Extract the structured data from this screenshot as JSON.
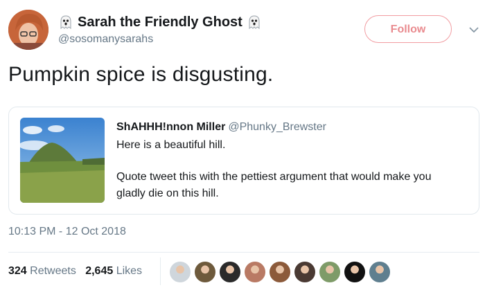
{
  "author": {
    "display_name": "Sarah the Friendly Ghost",
    "handle": "@sosomanysarahs",
    "name_emoji": "ghost-icon"
  },
  "follow_button": {
    "label": "Follow"
  },
  "menu_icon": "chevron-down-icon",
  "tweet": {
    "text": "Pumpkin spice is disgusting."
  },
  "quoted_tweet": {
    "display_name": "ShAHHH!nnon Miller",
    "handle": "@Phunky_Brewster",
    "line1": "Here is a beautiful hill.",
    "line2": "Quote tweet this with the pettiest argument that would make you",
    "line3": "gladly die on this hill."
  },
  "timestamp": "10:13 PM - 12 Oct 2018",
  "stats": {
    "retweets_count": "324",
    "retweets_label": "Retweets",
    "likes_count": "2,645",
    "likes_label": "Likes"
  },
  "likers": [
    {
      "name": "liker-avatar-1",
      "color": "#cfd6dc"
    },
    {
      "name": "liker-avatar-2",
      "color": "#6e5a3c"
    },
    {
      "name": "liker-avatar-3",
      "color": "#2a2a2a"
    },
    {
      "name": "liker-avatar-4",
      "color": "#b97a64"
    },
    {
      "name": "liker-avatar-5",
      "color": "#8c5a3a"
    },
    {
      "name": "liker-avatar-6",
      "color": "#4a3a33"
    },
    {
      "name": "liker-avatar-7",
      "color": "#7e9b68"
    },
    {
      "name": "liker-avatar-8",
      "color": "#111111"
    },
    {
      "name": "liker-avatar-9",
      "color": "#5f7f8f"
    }
  ],
  "colors": {
    "secondary_text": "#657786",
    "follow_border": "#f19ba0",
    "follow_text": "#e98b8f",
    "border": "#e1e8ed"
  }
}
